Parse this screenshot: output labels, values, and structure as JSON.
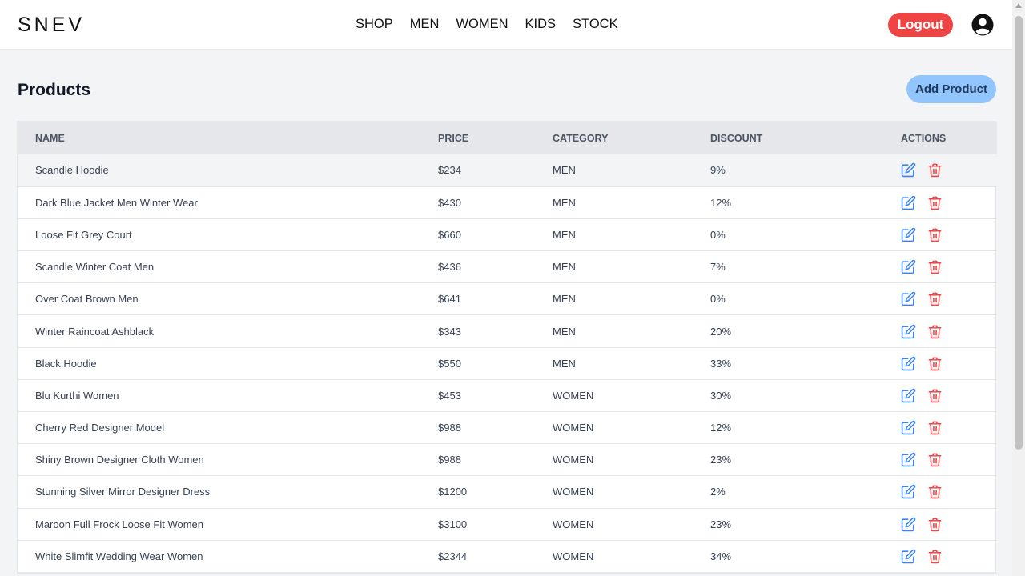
{
  "brand": {
    "logo": "SNEV"
  },
  "nav": {
    "links": [
      "SHOP",
      "MEN",
      "WOMEN",
      "KIDS",
      "STOCK"
    ],
    "logout_label": "Logout",
    "user_icon": "user-circle-icon"
  },
  "page": {
    "title": "Products",
    "add_label": "Add Product"
  },
  "table": {
    "columns": [
      "NAME",
      "PRICE",
      "CATEGORY",
      "DISCOUNT",
      "ACTIONS"
    ],
    "rows": [
      {
        "name": "Scandle Hoodie",
        "price": "$234",
        "category": "MEN",
        "discount": "9%"
      },
      {
        "name": "Dark Blue Jacket Men Winter Wear",
        "price": "$430",
        "category": "MEN",
        "discount": "12%"
      },
      {
        "name": "Loose Fit Grey Court",
        "price": "$660",
        "category": "MEN",
        "discount": "0%"
      },
      {
        "name": "Scandle Winter Coat Men",
        "price": "$436",
        "category": "MEN",
        "discount": "7%"
      },
      {
        "name": "Over Coat Brown Men",
        "price": "$641",
        "category": "MEN",
        "discount": "0%"
      },
      {
        "name": "Winter Raincoat Ashblack",
        "price": "$343",
        "category": "MEN",
        "discount": "20%"
      },
      {
        "name": "Black Hoodie",
        "price": "$550",
        "category": "MEN",
        "discount": "33%"
      },
      {
        "name": "Blu Kurthi Women",
        "price": "$453",
        "category": "WOMEN",
        "discount": "30%"
      },
      {
        "name": "Cherry Red Designer Model",
        "price": "$988",
        "category": "WOMEN",
        "discount": "12%"
      },
      {
        "name": "Shiny Brown Designer Cloth Women",
        "price": "$988",
        "category": "WOMEN",
        "discount": "23%"
      },
      {
        "name": "Stunning Silver Mirror Designer Dress",
        "price": "$1200",
        "category": "WOMEN",
        "discount": "2%"
      },
      {
        "name": "Maroon Full Frock Loose Fit Women",
        "price": "$3100",
        "category": "WOMEN",
        "discount": "23%"
      },
      {
        "name": "White Slimfit Wedding Wear Women",
        "price": "$2344",
        "category": "WOMEN",
        "discount": "34%"
      }
    ],
    "edit_icon": "edit-icon",
    "delete_icon": "trash-icon"
  },
  "colors": {
    "logout": "#ef4444",
    "add_button": "#93c5fd",
    "edit_icon": "#3b82f6",
    "delete_icon": "#ef4444"
  }
}
